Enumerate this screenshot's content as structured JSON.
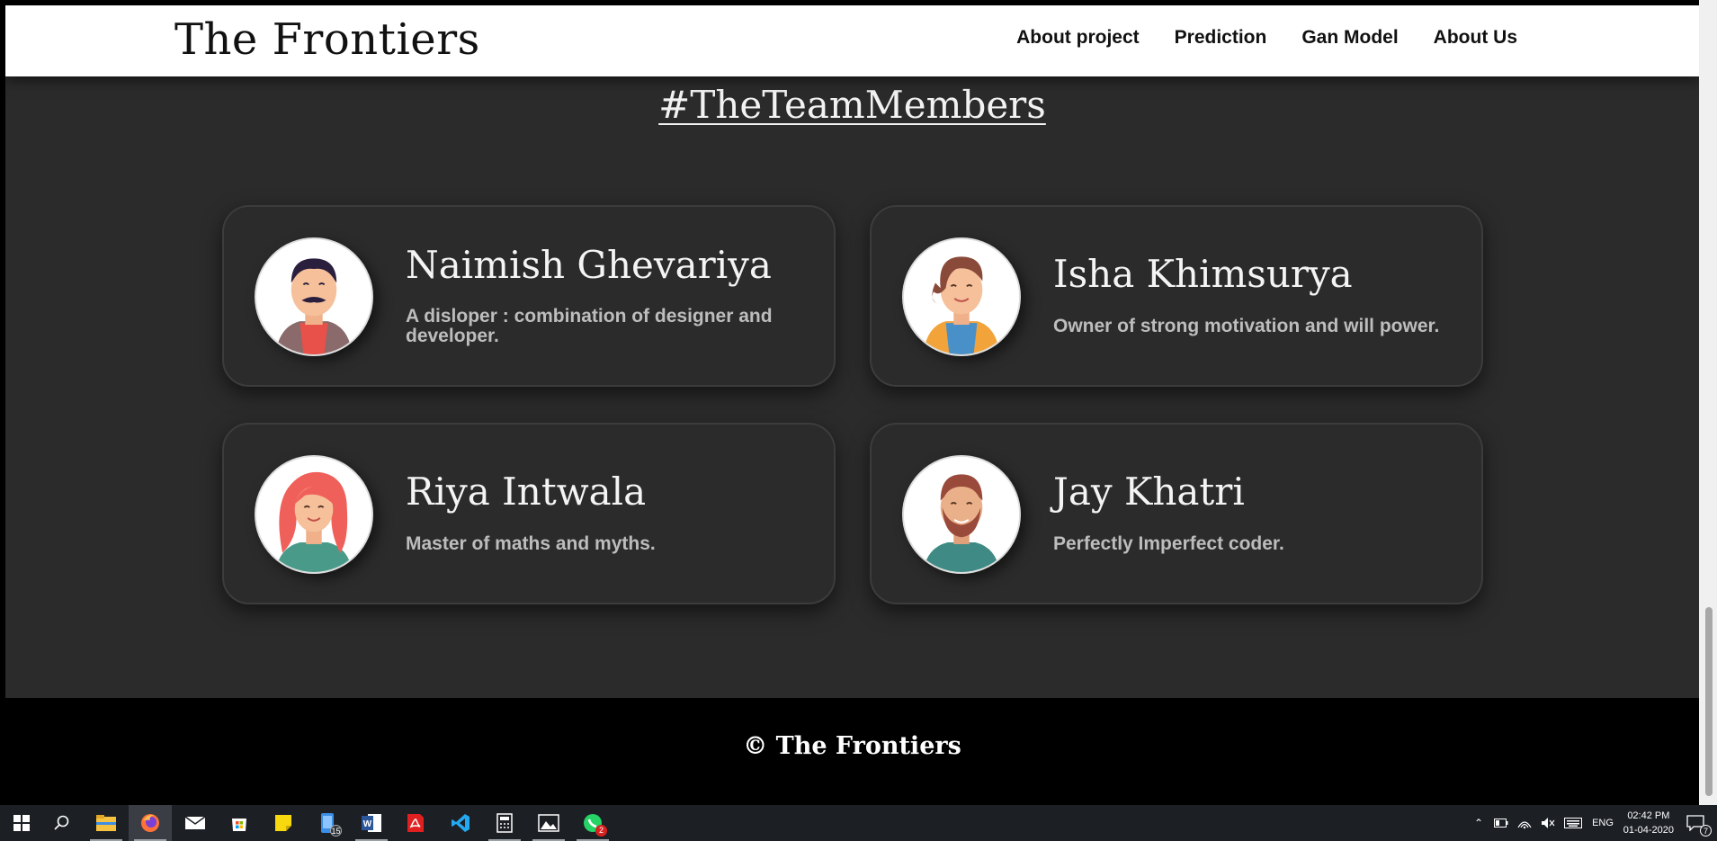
{
  "navbar": {
    "brand": "The Frontiers",
    "links": [
      "About project",
      "Prediction",
      "Gan Model",
      "About Us"
    ]
  },
  "section": {
    "title": "#TheTeamMembers"
  },
  "members": [
    {
      "name": "Naimish Ghevariya",
      "description": "A disloper : combination of designer and developer.",
      "avatar": "man-mustache-avatar"
    },
    {
      "name": "Isha Khimsurya",
      "description": "Owner of strong motivation and will power.",
      "avatar": "woman-brown-hair-avatar"
    },
    {
      "name": "Riya Intwala",
      "description": "Master of maths and myths.",
      "avatar": "woman-red-hair-avatar"
    },
    {
      "name": "Jay Khatri",
      "description": "Perfectly Imperfect coder.",
      "avatar": "man-beard-avatar"
    }
  ],
  "footer": {
    "text": "© The Frontiers"
  },
  "taskbar": {
    "apps": [
      "start-icon",
      "search-icon",
      "file-explorer-icon",
      "firefox-icon",
      "mail-icon",
      "store-icon",
      "sticky-notes-icon",
      "phone-icon",
      "word-icon",
      "acrobat-icon",
      "vscode-icon",
      "calculator-icon",
      "photos-icon",
      "whatsapp-icon"
    ],
    "badges": {
      "phone": "15",
      "whatsapp": "2"
    },
    "language": "ENG",
    "time": "02:42 PM",
    "date": "01-04-2020",
    "notifications": "7"
  },
  "colors": {
    "page_bg": "#2b2b2b",
    "navbar_bg": "#ffffff",
    "footer_bg": "#000000",
    "card_border": "#3c3c3c"
  }
}
